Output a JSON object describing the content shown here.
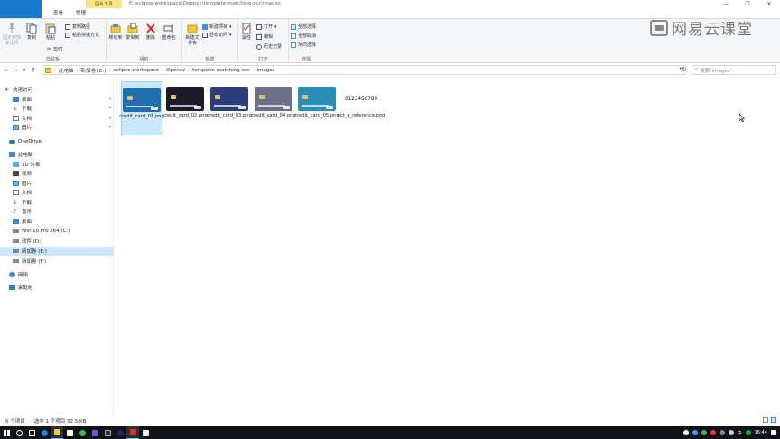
{
  "titlebar": {
    "context_tab": "图片工具",
    "path_title": "E:\\eclipse-workspace\\Opencv\\template-matching-ocr\\images",
    "minimize": "—",
    "maximize": "☐",
    "close": "✕"
  },
  "tabs": {
    "file": "文件",
    "home": "主页",
    "share": "共享",
    "view": "查看",
    "manage": "管理"
  },
  "ribbon": {
    "pin_quick": "固定到快速访问",
    "copy": "复制",
    "paste": "粘贴",
    "copy_path": "复制路径",
    "paste_shortcut": "粘贴快捷方式",
    "cut": "剪切",
    "clipboard_label": "剪贴板",
    "move_to": "移动到",
    "copy_to": "复制到",
    "delete": "删除",
    "rename": "重命名",
    "organize_label": "组织",
    "new_folder": "新建文件夹",
    "new_item": "新建项目",
    "easy_access": "轻松访问",
    "new_label": "新建",
    "properties": "属性",
    "open": "打开",
    "edit": "编辑",
    "history": "历史记录",
    "open_label": "打开",
    "select_all": "全部选择",
    "select_none": "全部取消",
    "invert_select": "反向选择",
    "select_label": "选择"
  },
  "logo": {
    "text": "网易云课堂"
  },
  "addressbar": {
    "crumbs": [
      "此电脑",
      "新加卷 (E:)",
      "eclipse-workspace",
      "Opencv",
      "template-matching-ocr",
      "images"
    ],
    "search_placeholder": "搜索\"images\""
  },
  "navpane": {
    "quick_access": "快速访问",
    "desktop_q": "桌面",
    "downloads_q": "下载",
    "documents_q": "文档",
    "pictures_q": "图片",
    "onedrive": "OneDrive",
    "this_pc": "此电脑",
    "objects3d": "3D 对象",
    "videos": "视频",
    "pictures": "图片",
    "documents": "文档",
    "downloads": "下载",
    "music": "音乐",
    "desktop": "桌面",
    "drive_c": "Win 10 Pro x64 (C:)",
    "drive_d": "软件 (D:)",
    "drive_e": "新加卷 (E:)",
    "drive_f": "新加卷 (F:)",
    "network": "网络",
    "homegroup": "家庭组"
  },
  "files": [
    {
      "name": "credit_card_01.png",
      "color": "#1f6fb0",
      "selected": true
    },
    {
      "name": "credit_card_02.png",
      "color": "#1a1c2a",
      "selected": false
    },
    {
      "name": "credit_card_03.png",
      "color": "#2b3d7a",
      "selected": false
    },
    {
      "name": "credit_card_04.png",
      "color": "#6b6f8a",
      "selected": false
    },
    {
      "name": "credit_card_05.png",
      "color": "#2a8fb8",
      "selected": false
    },
    {
      "name": "ocr_a_reference.png",
      "thumb_text": "0123456789",
      "selected": false
    }
  ],
  "statusbar": {
    "count": "6 个项目",
    "selection": "选中 1 个项目  32.5 KB"
  },
  "taskbar": {
    "ime": "中",
    "time": "16:44"
  }
}
